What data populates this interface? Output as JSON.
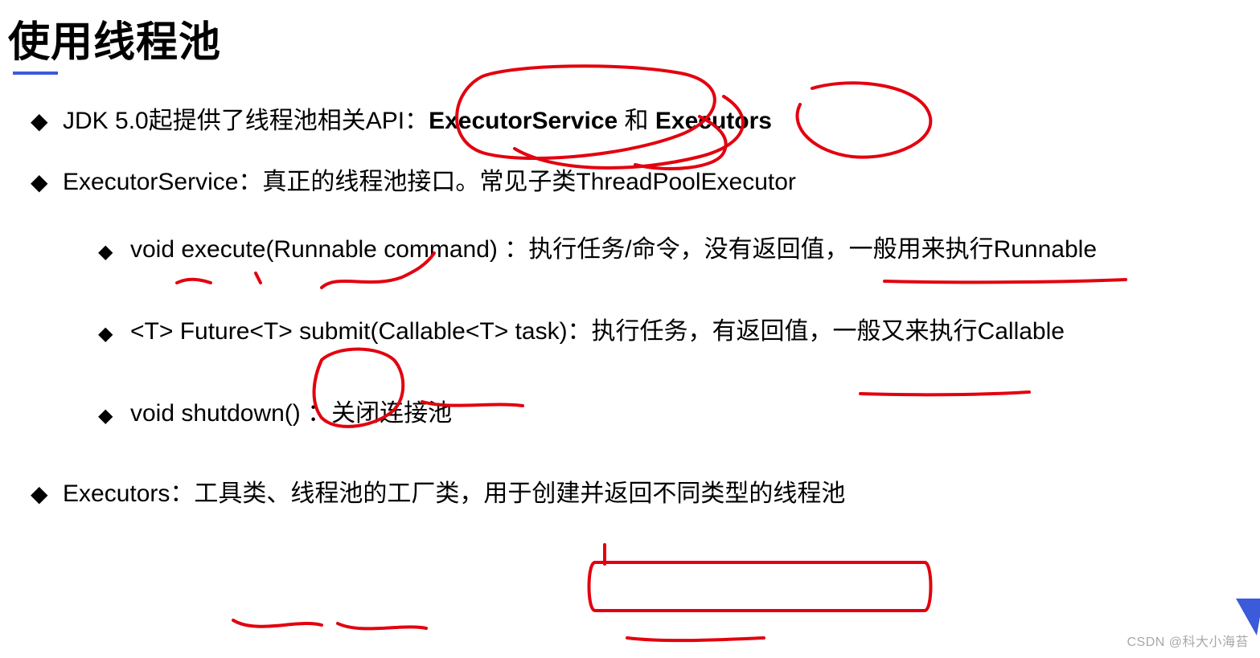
{
  "title": "使用线程池",
  "bullets": {
    "b1_pre": "JDK 5.0起提供了线程池相关API：",
    "b1_bold1": "ExecutorService",
    "b1_mid": " 和 ",
    "b1_bold2": "Executors",
    "b2": "ExecutorService：真正的线程池接口。常见子类ThreadPoolExecutor",
    "b2_sub1": "void execute(Runnable command) ：执行任务/命令，没有返回值，一般用来执行Runnable",
    "b2_sub2": "<T> Future<T> submit(Callable<T> task)：执行任务，有返回值，一般又来执行Callable",
    "b2_sub3": "void shutdown() ：关闭连接池",
    "b3": "Executors：工具类、线程池的工厂类，用于创建并返回不同类型的线程池"
  },
  "watermark": "CSDN @科大小海苔"
}
